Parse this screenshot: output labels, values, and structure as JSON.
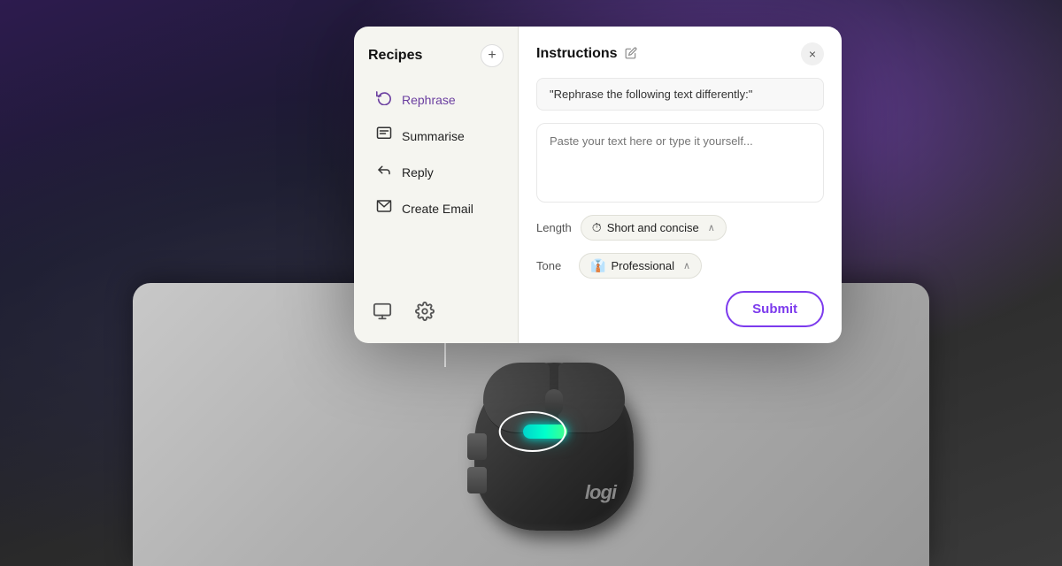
{
  "background": {
    "description": "Dark purple gradient background with Logitech mouse on mousepad"
  },
  "recipes_panel": {
    "title": "Recipes",
    "add_button_label": "+",
    "items": [
      {
        "id": "rephrase",
        "label": "Rephrase",
        "icon": "↺",
        "active": true
      },
      {
        "id": "summarise",
        "label": "Summarise",
        "icon": "☰",
        "active": false
      },
      {
        "id": "reply",
        "label": "Reply",
        "icon": "↩",
        "active": false
      },
      {
        "id": "create-email",
        "label": "Create Email",
        "icon": "✉",
        "active": false
      }
    ],
    "footer_icons": [
      {
        "id": "monitor",
        "label": "Monitor",
        "unicode": "⬛"
      },
      {
        "id": "settings",
        "label": "Settings",
        "unicode": "⚙"
      }
    ]
  },
  "instructions_panel": {
    "title": "Instructions",
    "close_label": "×",
    "prompt_text": "\"Rephrase the following text differently:\"",
    "textarea_placeholder": "Paste your text here or type it yourself...",
    "length_label": "Length",
    "length_icon": "⏱",
    "length_value": "Short and concise",
    "length_chevron": "∧",
    "tone_label": "Tone",
    "tone_icon": "👔",
    "tone_value": "Professional",
    "tone_chevron": "∧",
    "submit_label": "Submit"
  }
}
